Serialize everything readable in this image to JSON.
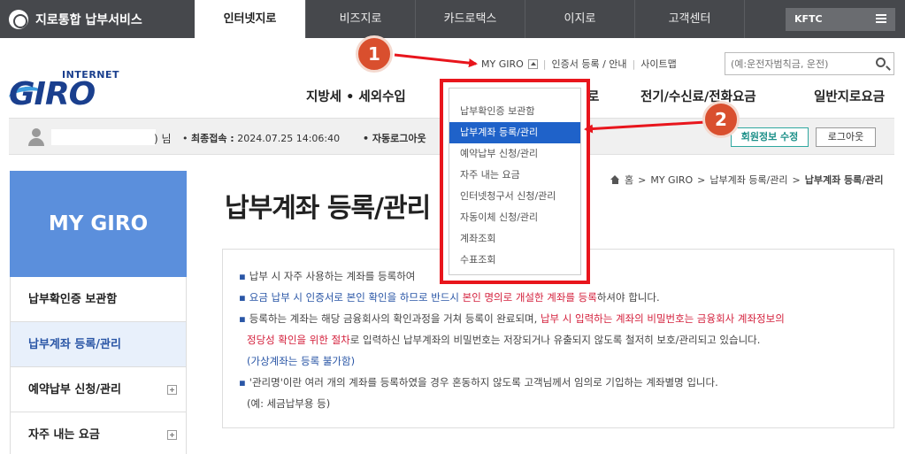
{
  "topbar": {
    "brand": "지로통합 납부서비스",
    "tabs": [
      "인터넷지로",
      "비즈지로",
      "카드로택스",
      "이지로",
      "고객센터"
    ],
    "active_tab": "인터넷지로",
    "kftc": "KFTC"
  },
  "logo": {
    "small": "INTERNET",
    "big": "GIRO"
  },
  "util": {
    "my_giro": "MY GIRO",
    "cert": "인증서 등록 / 안내",
    "sitemap": "사이트맵"
  },
  "search": {
    "placeholder": "(예:운전자범칙금, 운전)"
  },
  "mainnav": [
    "지방세 • 세외수입",
    "로",
    "전기/수신료/전화요금",
    "일반지로요금"
  ],
  "userbar": {
    "name_suffix": ") 님",
    "last_login_label": "최종접속 :",
    "last_login_value": "2024.07.25 14:06:40",
    "auto_logout": "자동로그아웃",
    "edit_button": "회원정보 수정",
    "logout_button": "로그아웃"
  },
  "sidebar": {
    "hero": "MY GIRO",
    "items": [
      {
        "label": "납부확인증 보관함",
        "active": false,
        "expandable": false
      },
      {
        "label": "납부계좌 등록/관리",
        "active": true,
        "expandable": false
      },
      {
        "label": "예약납부 신청/관리",
        "active": false,
        "expandable": true
      },
      {
        "label": "자주 내는 요금",
        "active": false,
        "expandable": true
      }
    ]
  },
  "breadcrumb": {
    "home": "홈",
    "level1": "MY GIRO",
    "level2": "납부계좌 등록/관리",
    "current": "납부계좌 등록/관리"
  },
  "page_title": "납부계좌 등록/관리",
  "info": {
    "l1": "납부 시 자주 사용하는 계좌를 등록하여",
    "l2_a": "요금 납부 시 인증서로 본인 확인을 하므로 반드시 ",
    "l2_b": "본인 명의로 개설한 계좌를 등록",
    "l2_c": "하셔야 합니다.",
    "l3_a": "등록하는 계좌는 해당 금융회사의 확인과정을 거쳐 등록이 완료되며, ",
    "l3_b": "납부 시 입력하는 계좌의 비밀번호는 금융회사 계좌정보의",
    "l4_a": "정당성 확인을 위한 절차",
    "l4_b": "로 입력하신 납부계좌의 비밀번호는 저장되거나 유출되지 않도록 철저히 보호/관리되고 있습니다.",
    "l5": "(가상계좌는 등록 불가함)",
    "l6": "'관리명'이란 여러 개의 계좌를 등록하였을 경우 혼동하지 않도록 고객님께서 임의로 기입하는 계좌별명 입니다.",
    "l7": "(예: 세금납부용 등)"
  },
  "dropdown": {
    "items": [
      "납부확인증 보관함",
      "납부계좌 등록/관리",
      "예약납부 신청/관리",
      "자주 내는 요금",
      "인터넷청구서 신청/관리",
      "자동이체 신청/관리",
      "계좌조회",
      "수표조회"
    ],
    "active_index": 1
  },
  "callouts": [
    "1",
    "2"
  ],
  "colors": {
    "topbar": "#46484c",
    "accent_blue": "#1f62c9",
    "highlight_red": "#e8151c",
    "callout": "#d94f2e",
    "sidebar_hero": "#5b8fdc"
  }
}
